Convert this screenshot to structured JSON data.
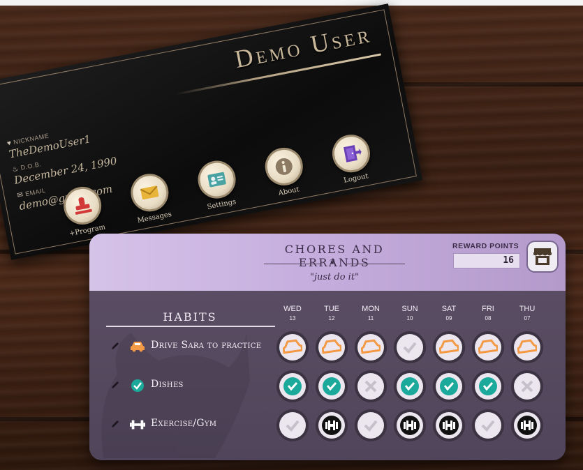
{
  "profile": {
    "name": "Demo User",
    "nickname_label": "NICKNAME",
    "nickname": "TheDemoUser1",
    "dob_label": "D.O.B.",
    "dob": "December 24, 1990",
    "email_label": "EMAIL",
    "email": "demo@gmail.com",
    "menu": [
      {
        "label": "+Program",
        "icon": "stamp-icon",
        "color": "#d23a3a"
      },
      {
        "label": "Messages",
        "icon": "envelope-icon",
        "color": "#e8b53a"
      },
      {
        "label": "Settings",
        "icon": "id-card-icon",
        "color": "#4aa3a3"
      },
      {
        "label": "About",
        "icon": "info-icon",
        "color": "#8d7a62"
      },
      {
        "label": "Logout",
        "icon": "door-exit-icon",
        "color": "#6b3fb5"
      }
    ]
  },
  "panel": {
    "title": "CHORES AND ERRANDS",
    "subtitle": "\"just do it\"",
    "reward_label": "REWARD POINTS",
    "reward_points": "16",
    "store_icon": "store-icon",
    "habits_header": "HABITS",
    "days": [
      {
        "name": "WED",
        "date": "13"
      },
      {
        "name": "TUE",
        "date": "12"
      },
      {
        "name": "MON",
        "date": "11"
      },
      {
        "name": "SUN",
        "date": "10"
      },
      {
        "name": "SAT",
        "date": "09"
      },
      {
        "name": "FRI",
        "date": "08"
      },
      {
        "name": "THU",
        "date": "07"
      }
    ],
    "habits": [
      {
        "name": "Drive Sara to practice",
        "icon": "car-icon",
        "color": "#f29a45",
        "cells": [
          "stamp",
          "stamp",
          "stamp",
          "check",
          "stamp",
          "stamp",
          "stamp"
        ]
      },
      {
        "name": "Dishes",
        "icon": "check-circle-icon",
        "color": "#1aa99a",
        "cells": [
          "stamp",
          "stamp",
          "cross",
          "stamp",
          "stamp",
          "stamp",
          "cross"
        ]
      },
      {
        "name": "Exercise/Gym",
        "icon": "dumbbell-icon",
        "color": "#111111",
        "cells": [
          "check",
          "stamp",
          "check",
          "stamp",
          "stamp",
          "check",
          "stamp"
        ]
      }
    ]
  }
}
